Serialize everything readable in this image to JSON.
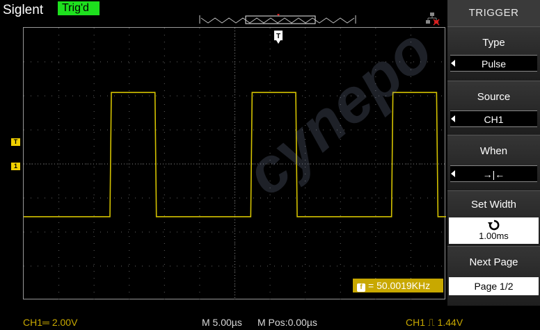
{
  "header": {
    "brand": "Siglent",
    "trigger_status": "Trig'd"
  },
  "menu": {
    "title": "TRIGGER",
    "items": [
      {
        "label": "Type",
        "value": "Pulse"
      },
      {
        "label": "Source",
        "value": "CH1"
      },
      {
        "label": "When",
        "value": "→|←"
      },
      {
        "label": "Set Width",
        "value": "1.00ms"
      },
      {
        "label": "Next Page",
        "value": "Page 1/2"
      }
    ]
  },
  "measurement": {
    "frequency": "= 50.0019KHz"
  },
  "status": {
    "ch1_scale": "CH1═ 2.00V",
    "timebase": "M 5.00µs",
    "position": "M Pos:0.00µs",
    "trigger_level": "CH1 ⎍ 1.44V"
  },
  "markers": {
    "trig_level_marker": "T",
    "ch1_marker": "1",
    "trig_pos_marker": "T",
    "freq_icon": "f"
  },
  "waveform": {
    "channel": "CH1",
    "color": "#d4c200",
    "type": "square",
    "frequency_khz": 50.0019,
    "high_level_div": 2.1,
    "low_level_div": -1.55
  },
  "colors": {
    "trace": "#d4c200",
    "trig_status_bg": "#1ee01e",
    "accent": "#c8a800"
  },
  "watermark": "cynepo"
}
